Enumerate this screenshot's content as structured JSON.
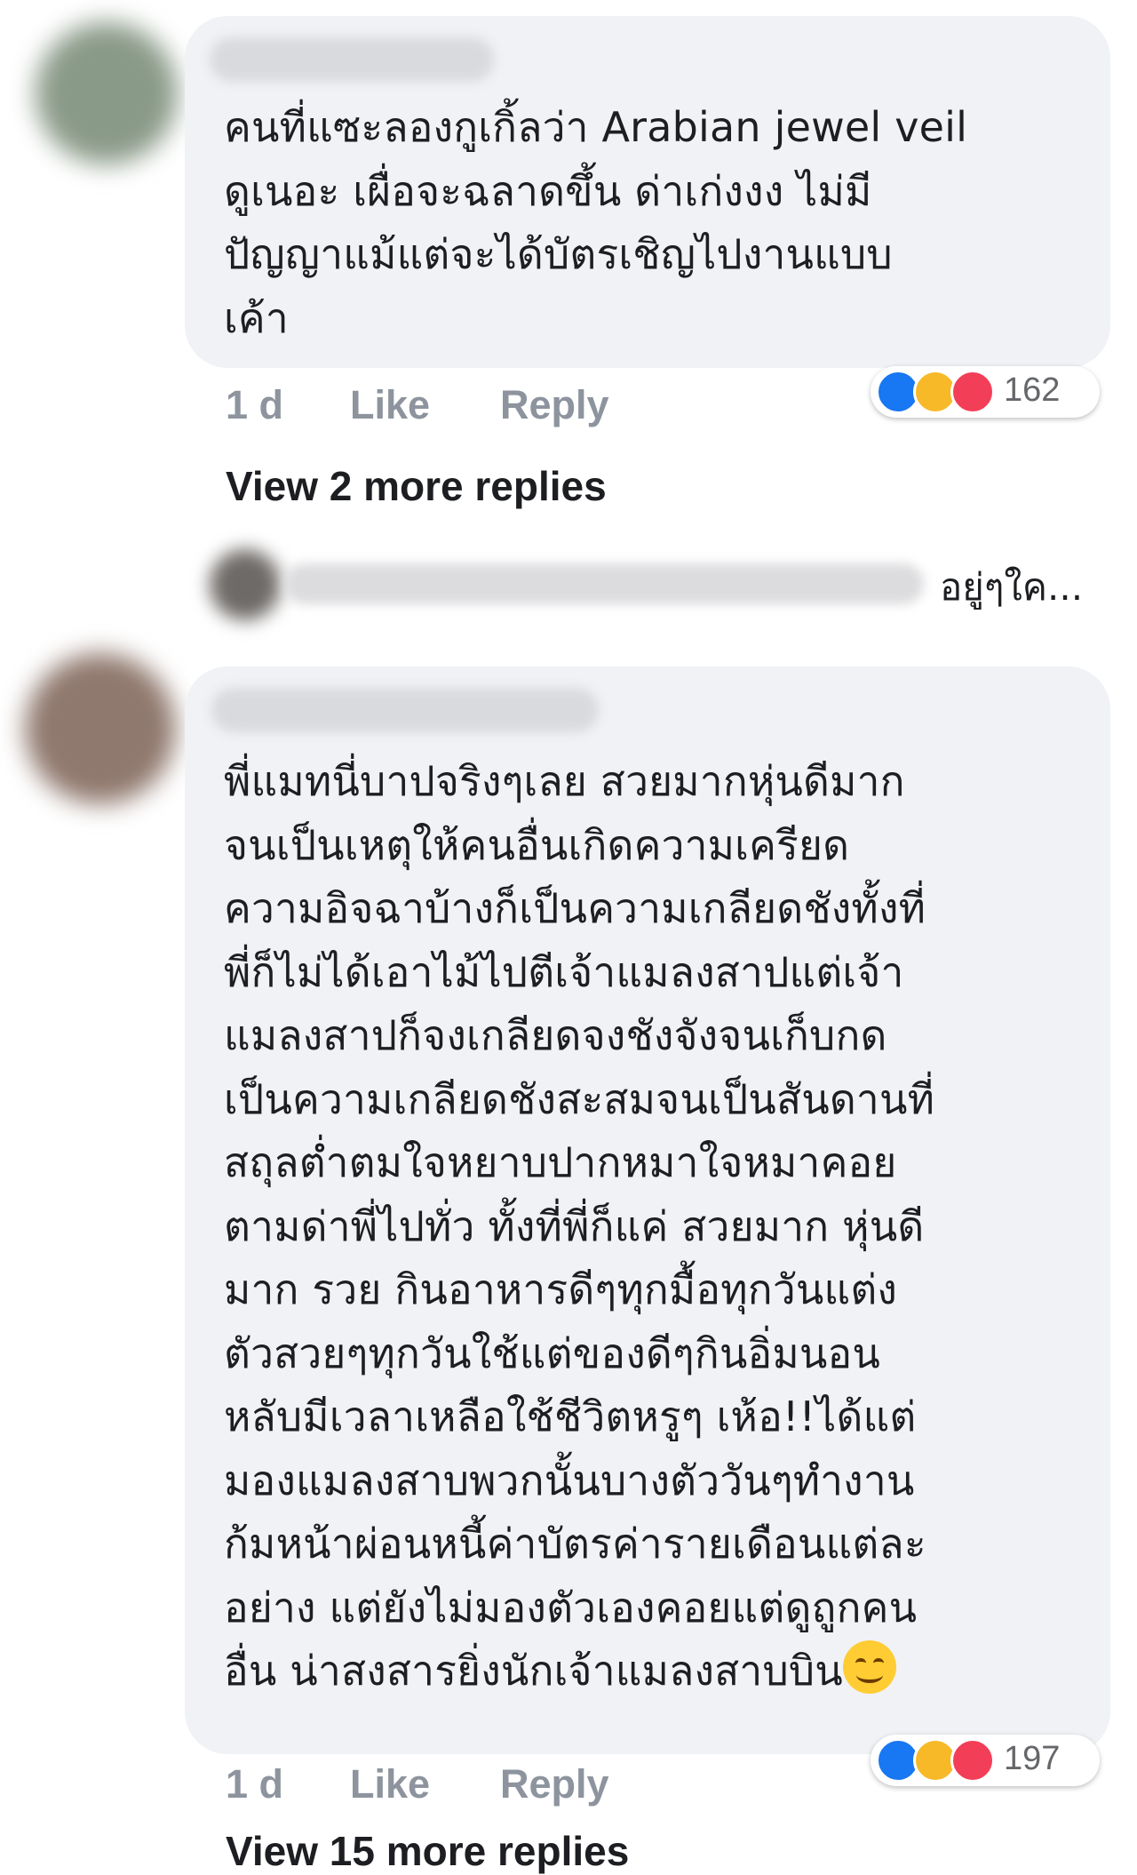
{
  "comments": [
    {
      "text": "คนที่แซะลองกูเกิ้ลว่า Arabian jewel veil\nดูเนอะ เผื่อจะฉลาดขึ้น ด่าเก่งงง ไม่มี\nปัญญาแม้แต่จะได้บัตรเชิญไปงานแบบ\nเค้า",
      "time": "1 d",
      "like_label": "Like",
      "reply_label": "Reply",
      "reaction_count": "162",
      "reaction_icons": [
        "like-icon",
        "haha-icon",
        "love-icon"
      ],
      "view_replies": "View 2 more replies"
    },
    {
      "text": "พี่แมทนี่บาปจริงๆเลย สวยมากหุ่นดีมาก\nจนเป็นเหตุให้คนอื่นเกิดความเครียด\nความอิจฉาบ้างก็เป็นความเกลียดชังทั้งที่\nพี่ก็ไม่ได้เอาไม้ไปตีเจ้าแมลงสาปแต่เจ้า\nแมลงสาปก็จงเกลียดจงชังจังจนเก็บกด\nเป็นความเกลียดชังสะสมจนเป็นสันดานที่\nสถุลต่ำตมใจหยาบปากหมาใจหมาคอย\nตามด่าพี่ไปทั่ว ทั้งที่พี่ก็แค่ สวยมาก หุ่นดี\nมาก รวย กินอาหารดีๆทุกมื้อทุกวันแต่ง\nตัวสวยๆทุกวันใช้แต่ของดีๆกินอิ่มนอน\nหลับมีเวลาเหลือใช้ชีวิตหรูๆ เห้อ!!ได้แต่\nมองแมลงสาบพวกนั้นบางตัววันๆทำงาน\nก้มหน้าผ่อนหนี้ค่าบัตรค่ารายเดือนแต่ละ\nอย่าง แต่ยังไม่มองตัวเองคอยแต่ดูถูกคน\nอื่น น่าสงสารยิ่งนักเจ้าแมลงสาบบิน",
      "trailing_emoji": "smiling-face-icon",
      "time": "1 d",
      "like_label": "Like",
      "reply_label": "Reply",
      "reaction_count": "197",
      "reaction_icons": [
        "like-icon",
        "haha-icon",
        "love-icon"
      ],
      "view_replies": "View 15 more replies"
    }
  ],
  "reply_preview": {
    "text": "อยู่ๆใค..."
  },
  "colors": {
    "bubble": "#f0f2f5",
    "text": "#1c1e21",
    "meta": "#8d949e",
    "like_blue": "#1877f2",
    "haha_yellow": "#f7b928",
    "love_red": "#f33e58"
  }
}
